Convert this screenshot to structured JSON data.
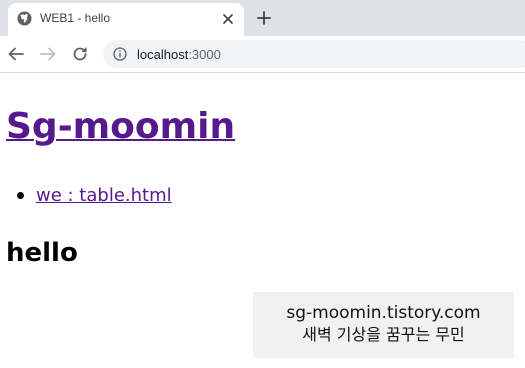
{
  "browser": {
    "tab": {
      "title": "WEB1 - hello",
      "favicon_icon": "globe-icon",
      "close_icon": "close-icon"
    },
    "new_tab_icon": "plus-icon",
    "toolbar": {
      "back_icon": "arrow-left-icon",
      "forward_icon": "arrow-right-icon",
      "reload_icon": "reload-icon",
      "info_icon": "info-icon",
      "url_host": "localhost",
      "url_port": ":3000"
    }
  },
  "page": {
    "site_title": "Sg-moomin",
    "topics": [
      {
        "label": "we : table.html"
      }
    ],
    "heading": "hello"
  },
  "watermark": {
    "line1": "sg-moomin.tistory.com",
    "line2": "새벽 기상을 꿈꾸는 무민"
  },
  "colors": {
    "visited_link": "#551a8b",
    "tabstrip_bg": "#dee1e6",
    "omnibox_bg": "#f1f3f4"
  }
}
